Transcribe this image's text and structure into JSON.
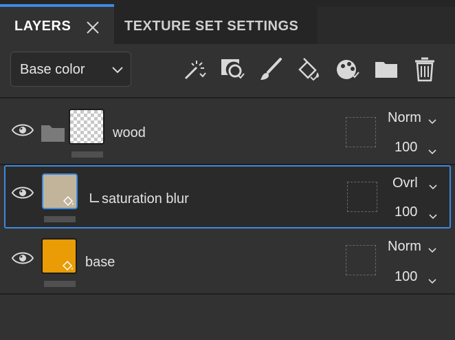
{
  "tabs": {
    "layers": "LAYERS",
    "texture_set_settings": "TEXTURE SET SETTINGS"
  },
  "toolbar": {
    "channel": "Base color",
    "tools": [
      "add-effect-icon",
      "add-mask-icon",
      "add-paint-layer-icon",
      "add-fill-layer-icon",
      "add-smart-material-icon",
      "add-folder-icon",
      "delete-icon"
    ]
  },
  "layers": [
    {
      "name": "wood",
      "type": "folder",
      "blend": "Norm",
      "opacity": "100",
      "thumb": "transparent"
    },
    {
      "name": "saturation blur",
      "type": "fill",
      "child": true,
      "blend": "Ovrl",
      "opacity": "100",
      "thumb_color": "#c2b49b",
      "selected": true
    },
    {
      "name": "base",
      "type": "fill",
      "blend": "Norm",
      "opacity": "100",
      "thumb_color": "#e99c05"
    }
  ],
  "colors": {
    "accent": "#3f8ae0",
    "panel": "#323232"
  }
}
